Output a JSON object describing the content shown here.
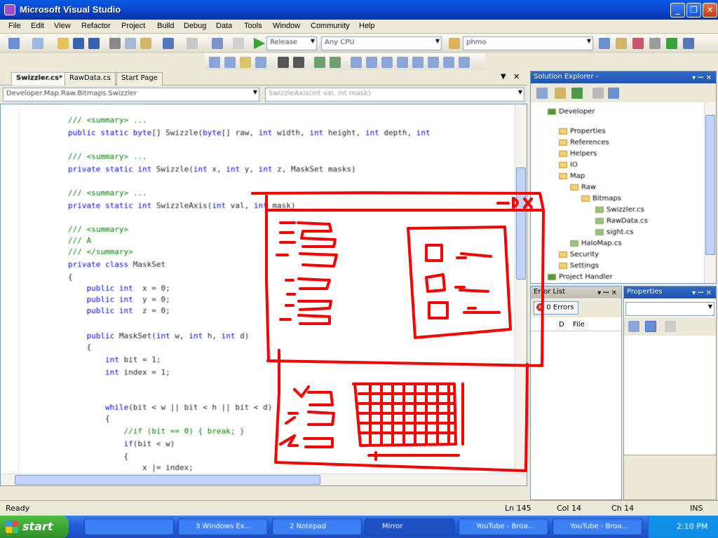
{
  "window": {
    "title": "Microsoft Visual Studio"
  },
  "menu": [
    "File",
    "Edit",
    "View",
    "Refactor",
    "Project",
    "Build",
    "Debug",
    "Data",
    "Tools",
    "Window",
    "Community",
    "Help"
  ],
  "toolbar": {
    "config": "Release",
    "platform": "Any CPU",
    "find": "phmo"
  },
  "doc_tabs": [
    "Swizzler.cs*",
    "RawData.cs",
    "Start Page"
  ],
  "nav": {
    "type_combo": "Developer.Map.Raw.Bitmaps.Swizzler",
    "member_combo": "SwizzleAxis(int val, int mask)"
  },
  "solution_explorer": {
    "title": "Solution Explorer -",
    "items": [
      "Developer",
      "Properties",
      "References",
      "Helpers",
      "IO",
      "Map",
      "Raw",
      "Bitmaps",
      "Swizzler.cs",
      "RawData.cs",
      "sight.cs",
      "HaloMap.cs",
      "Security",
      "Settings",
      "Project Handler"
    ]
  },
  "error_list": {
    "title": "Error List",
    "errors_btn": "0 Errors",
    "col_d": "D",
    "col_file": "File"
  },
  "properties": {
    "title": "Properties"
  },
  "status": {
    "ready": "Ready",
    "ln": "Ln 145",
    "col": "Col 14",
    "ch": "Ch 14",
    "ins": "INS"
  },
  "taskbar": {
    "start": "start",
    "tasks": [
      "",
      "3 Windows Ex...",
      "2 Notepad",
      "Mirror",
      "YouTube - Broa...",
      "YouTube - Broa..."
    ]
  }
}
